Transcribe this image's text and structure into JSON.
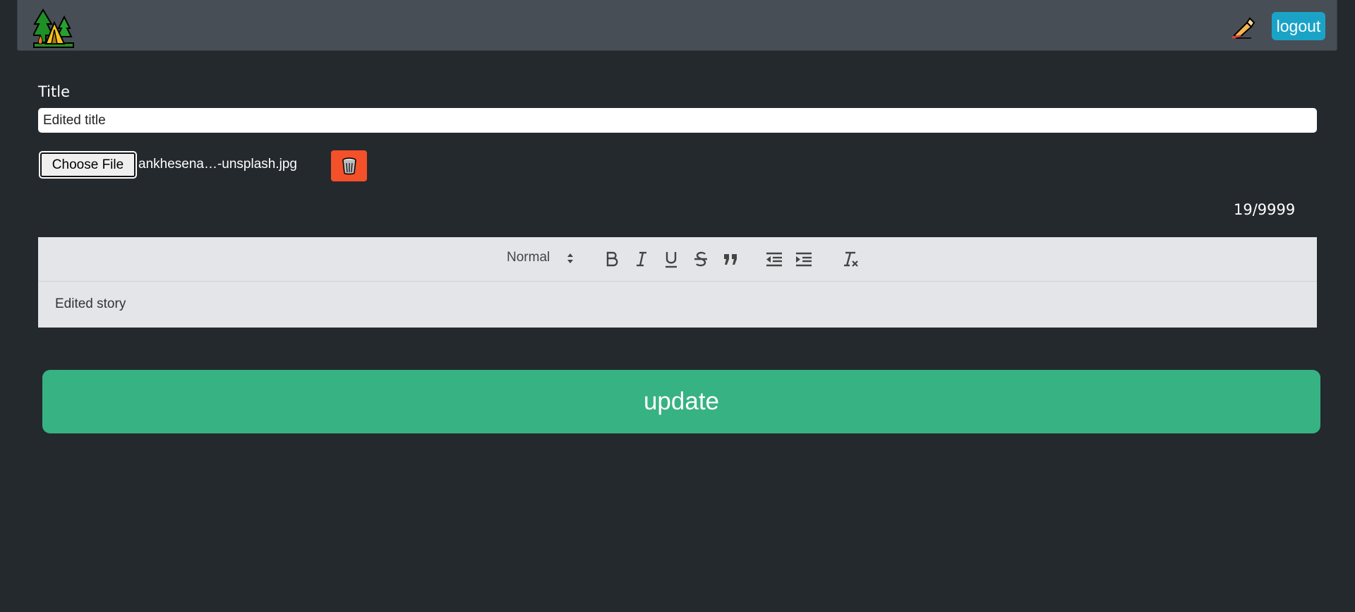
{
  "navbar": {
    "logo_icon": "camping-tent-trees-icon",
    "write_icon": "writing-hand-icon",
    "logout_label": "logout"
  },
  "form": {
    "title_label": "Title",
    "title_value": "Edited title",
    "choose_file_label": "Choose File",
    "file_name": "ankhesena…-unsplash.jpg",
    "delete_icon": "trash-can-icon",
    "char_counter": "19/9999"
  },
  "editor": {
    "header_select": "Normal",
    "toolbar_buttons": [
      "bold",
      "italic",
      "underline",
      "strike",
      "blockquote",
      "outdent",
      "indent",
      "clean"
    ],
    "content": "Edited story"
  },
  "update_label": "update",
  "colors": {
    "background": "#24292d",
    "navbar": "#474e56",
    "logout": "#1aa3c7",
    "delete": "#f4502a",
    "update": "#37b282",
    "editor": "#e4e5e8"
  }
}
